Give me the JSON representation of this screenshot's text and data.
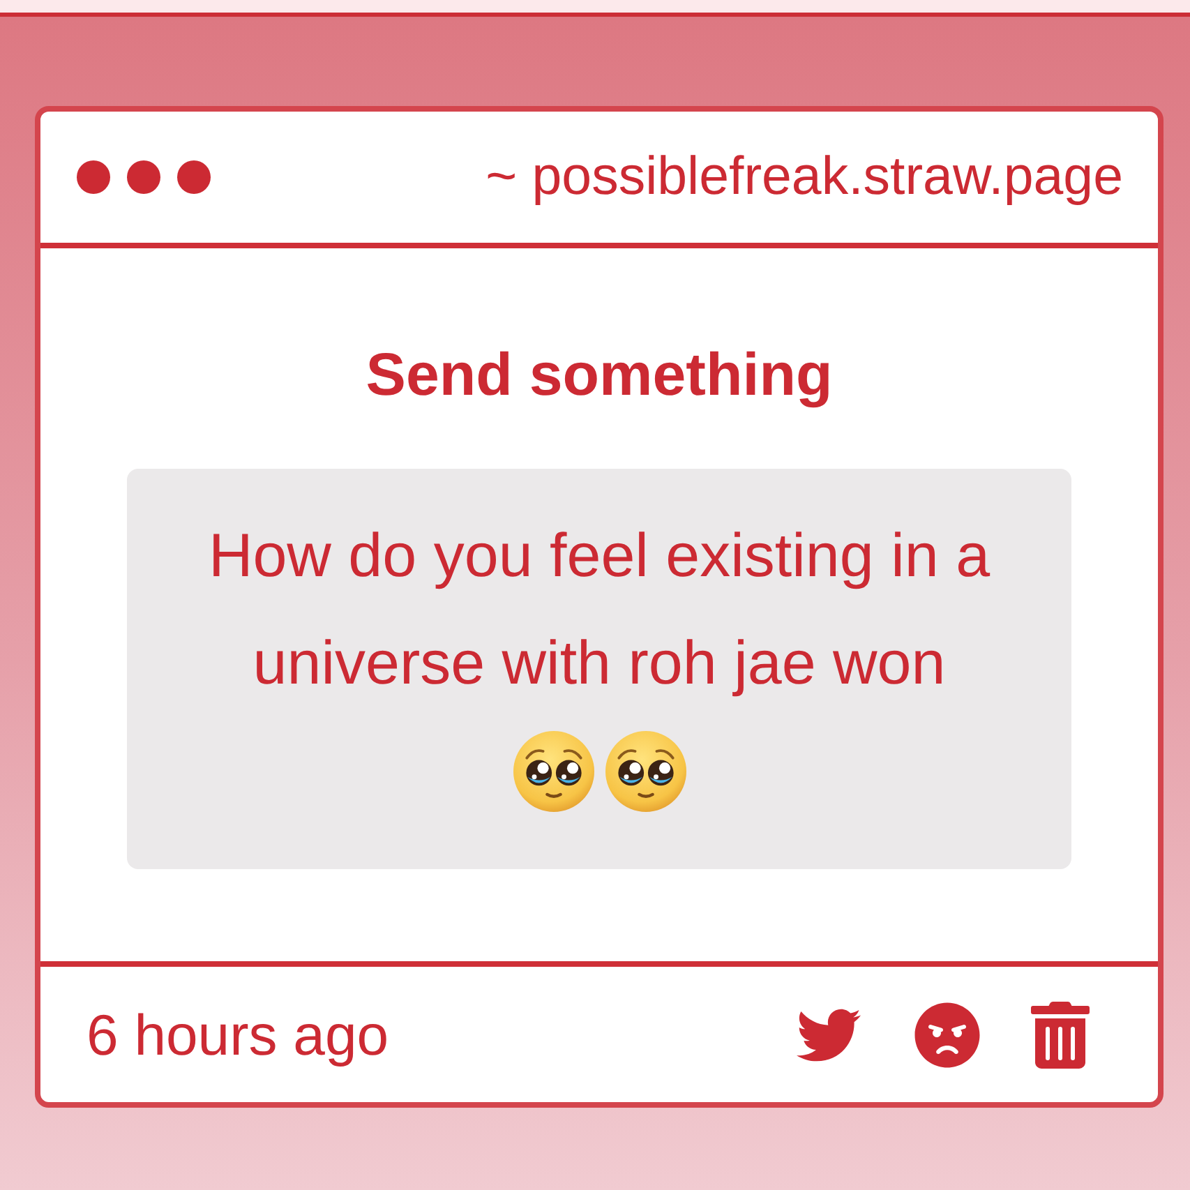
{
  "window": {
    "url": "~ possiblefreak.straw.page"
  },
  "message": {
    "title": "Send something",
    "question": "How do you feel existing in a universe with roh jae won"
  },
  "footer": {
    "time": "6 hours ago"
  }
}
